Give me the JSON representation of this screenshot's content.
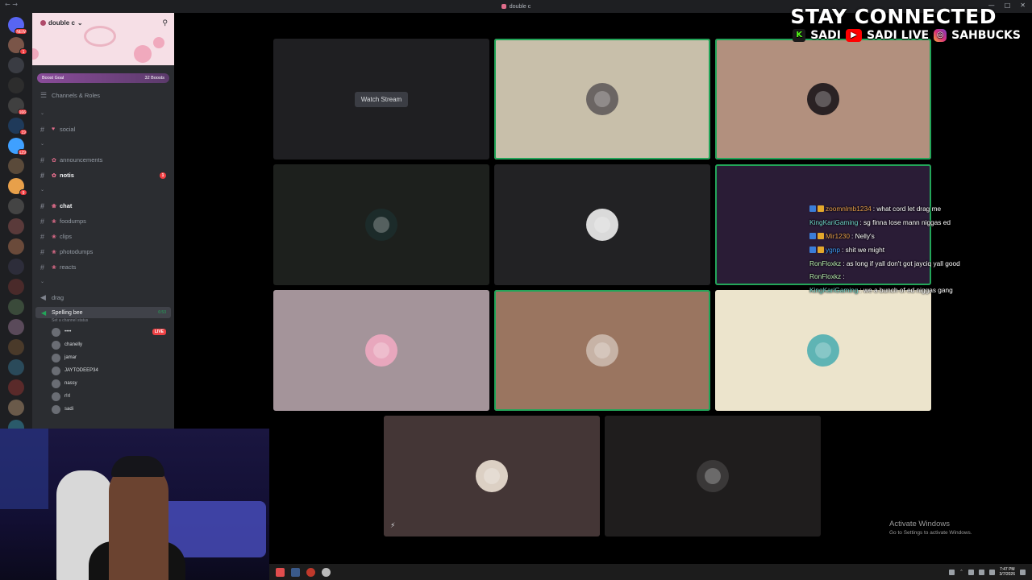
{
  "window": {
    "title": "double c"
  },
  "overlay": {
    "headline": "STAY CONNECTED",
    "socials": [
      {
        "icon": "kick-icon",
        "glyph": "K",
        "label": "SADI"
      },
      {
        "icon": "youtube-icon",
        "glyph": "▶",
        "label": "SADI LIVE"
      },
      {
        "icon": "instagram-icon",
        "glyph": "◎",
        "label": "SAHBUCKS"
      }
    ]
  },
  "server": {
    "name": "double c",
    "boost_goal": "Boost Goal",
    "boost_count": "32 Boosts",
    "channels_roles": "Channels & Roles"
  },
  "rail_badges": [
    "NEW",
    "1",
    "",
    "",
    "166",
    "19",
    "129",
    "",
    "9",
    "",
    "",
    "",
    "",
    "",
    "",
    "",
    "",
    "",
    "",
    "",
    ""
  ],
  "channels": {
    "social": "social",
    "announcements": "announcements",
    "notis": "notis",
    "notis_unread": "1",
    "chat": "chat",
    "foodumps": "foodumps",
    "clips": "clips",
    "photodumps": "photodumps",
    "reacts": "reacts",
    "drag": "drag"
  },
  "voice": {
    "channel": "Spelling bee",
    "time": "6:53",
    "status_hint": "Set a channel status",
    "live_label": "LIVE",
    "users": [
      "chanelly",
      "jamar",
      "JAYTODEEP34",
      "nassy",
      "r!rl",
      "sadi"
    ]
  },
  "stage": {
    "watch_stream": "Watch Stream"
  },
  "chat": [
    {
      "name": "zoomnlmb1234",
      "color": "#e8a04a",
      "text": ": what cord let drag me"
    },
    {
      "name": "KingKariGaming",
      "color": "#6fd6c9",
      "text": ": sg finna lose mann niggas ed"
    },
    {
      "name": "Mir1230",
      "color": "#e8a04a",
      "text": ": Nelly's"
    },
    {
      "name": "ygnp",
      "color": "#3fa0ff",
      "text": ": shit we might"
    },
    {
      "name": "RonFloxkz",
      "color": "#b9f0b0",
      "text": ": as long if yall don't got jayciq yall good"
    },
    {
      "name": "RonFloxkz",
      "color": "#b9f0b0",
      "text": ":"
    },
    {
      "name": "KingKariGaming",
      "color": "#6fd6c9",
      "text": ": we a bunch of ed niggas gang"
    }
  ],
  "activate": {
    "title": "Activate Windows",
    "subtitle": "Go to Settings to activate Windows."
  },
  "taskbar": {
    "time": "7:47 PM",
    "date": "3/7/2026"
  },
  "colors": {
    "speaking": "#23a559",
    "live": "#ed4245",
    "sidebar": "#2b2d31"
  }
}
